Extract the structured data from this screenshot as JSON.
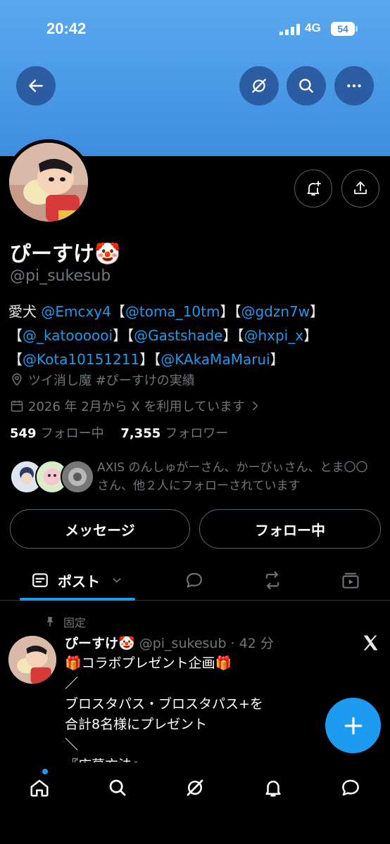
{
  "status_bar": {
    "time": "20:42",
    "network": "4G",
    "battery": "54"
  },
  "profile": {
    "display_name": "ぴーすけ🤡",
    "handle": "@pi_sukesub",
    "bio_line1_prefix": "愛犬 ",
    "bio_line1_items": [
      "@Emcxy4",
      "【",
      "@toma_10tm",
      "】【",
      "@gdzn7w",
      "】"
    ],
    "bio_line2_items": [
      "【",
      "@_katoooooi",
      "】【",
      "@Gastshade",
      "】【",
      "@hxpi_x",
      "】"
    ],
    "bio_line3_items": [
      "【",
      "@Kota10151211",
      "】【",
      "@KAkaMaMarui",
      "】"
    ],
    "location": "ツイ消し魔 #ぴーすけの実績",
    "joined": "2026 年 2月から X を利用しています",
    "following_count": "549",
    "following_label": "フォロー中",
    "followers_count": "7,355",
    "followers_label": "フォロワー",
    "followed_by_text": "AXIS のんしゅがーさん、かーびぃさん、とま〇〇さん、他２人にフォローされています"
  },
  "buttons": {
    "message": "メッセージ",
    "following": "フォロー中"
  },
  "tabs": {
    "posts": "ポスト"
  },
  "pinned_post": {
    "pinned_label": "固定",
    "name": "ぴーすけ🤡",
    "handle_time": "@pi_sukesub · 42 分",
    "body": "🎁コラボプレゼント企画🎁\n／\nブロスタパス・ブロスタパス+を\n合計8名様にプレゼント\n＼\n『応募方法』"
  },
  "colors": {
    "accent": "#1d9bf0",
    "banner": "#3d8ee0",
    "background": "#000000",
    "muted": "#71767b"
  },
  "icons": [
    "back-arrow-icon",
    "grok-icon",
    "search-icon",
    "more-icon",
    "bell-plus-icon",
    "share-icon",
    "location-icon",
    "calendar-icon",
    "post-tab-icon",
    "replies-icon",
    "repost-icon",
    "media-icon",
    "pin-icon",
    "x-logo-icon",
    "plus-icon",
    "home-icon",
    "notifications-icon",
    "messages-icon"
  ]
}
